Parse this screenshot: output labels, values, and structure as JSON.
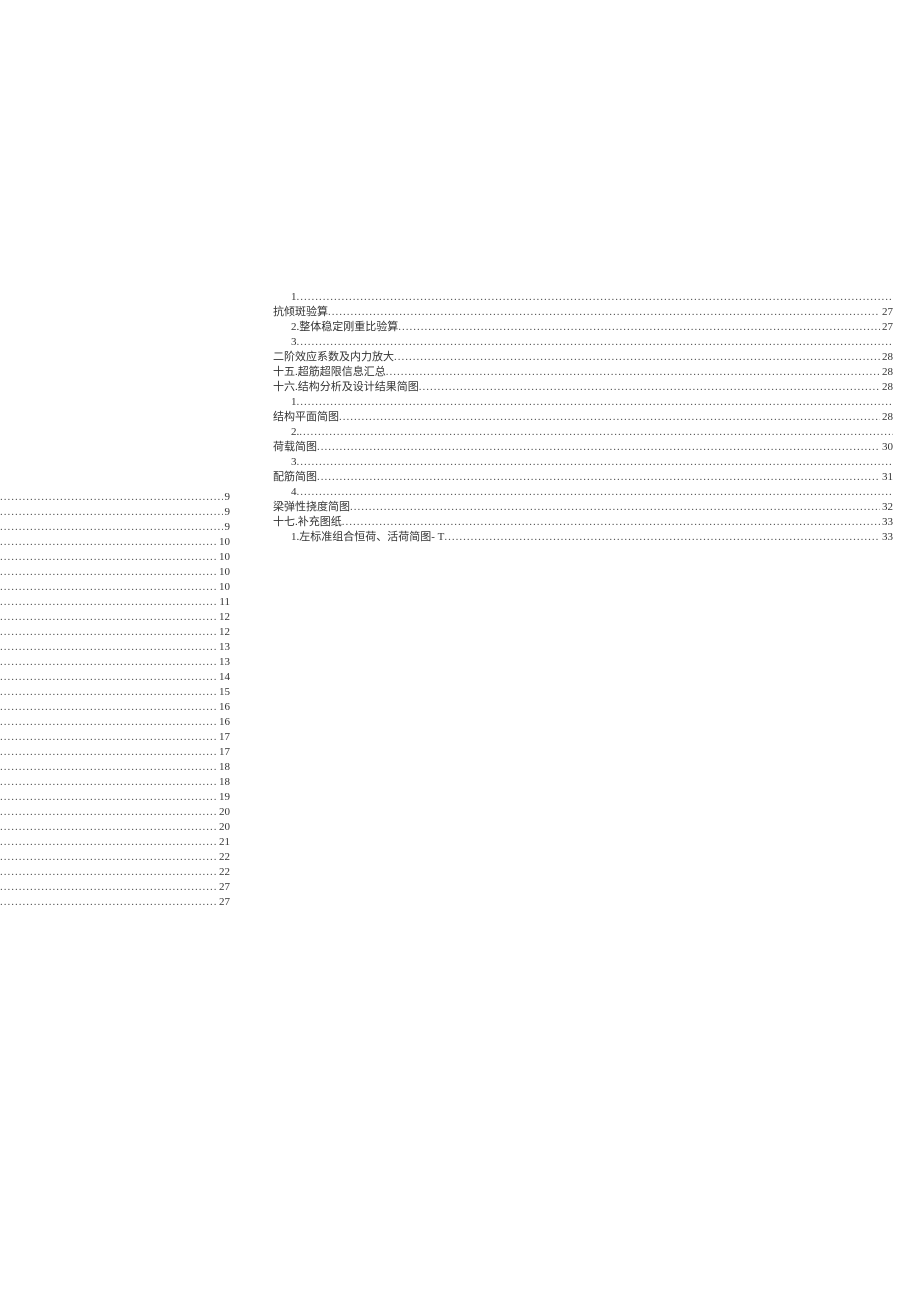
{
  "left_column": [
    {
      "title": "",
      "page": "9"
    },
    {
      "title": "",
      "page": "9"
    },
    {
      "title": "",
      "page": "9"
    },
    {
      "title": "",
      "page": "10"
    },
    {
      "title": "",
      "page": "10"
    },
    {
      "title": "",
      "page": "10"
    },
    {
      "title": "",
      "page": "10"
    },
    {
      "title": "",
      "page": "11"
    },
    {
      "title": "",
      "page": "12"
    },
    {
      "title": "",
      "page": "12"
    },
    {
      "title": "",
      "page": "13"
    },
    {
      "title": "",
      "page": "13"
    },
    {
      "title": "",
      "page": "14"
    },
    {
      "title": "",
      "page": "15"
    },
    {
      "title": "",
      "page": "16"
    },
    {
      "title": "",
      "page": "16"
    },
    {
      "title": "",
      "page": "17"
    },
    {
      "title": "",
      "page": "17"
    },
    {
      "title": "",
      "page": "18"
    },
    {
      "title": "",
      "page": "18"
    },
    {
      "title": "",
      "page": "19"
    },
    {
      "title": "",
      "page": "20"
    },
    {
      "title": "",
      "page": "20"
    },
    {
      "title": "",
      "page": "21"
    },
    {
      "title": "",
      "page": "22"
    },
    {
      "title": "",
      "page": "22"
    },
    {
      "title": "",
      "page": "27"
    },
    {
      "title": "",
      "page": "27"
    }
  ],
  "right_column": [
    {
      "title": "1",
      "page": "",
      "indent": true,
      "no_page": true
    },
    {
      "title": "抗倾斑验算",
      "page": "27"
    },
    {
      "title": "2.整体稳定刚重比验算",
      "page": "27",
      "indent": true
    },
    {
      "title": "3",
      "page": "",
      "indent": true,
      "no_page": true
    },
    {
      "title": "二阶效应系数及内力放大",
      "page": "28"
    },
    {
      "title": "十五.超筋超限信息汇总",
      "page": "28"
    },
    {
      "title": "十六.结构分析及设计结果简图",
      "page": "28"
    },
    {
      "title": "1",
      "page": "",
      "indent": true,
      "no_page": true
    },
    {
      "title": "结构平面简图",
      "page": "28"
    },
    {
      "title": "2.",
      "page": "",
      "indent": true,
      "no_page": true
    },
    {
      "title": "荷载简图",
      "page": "30"
    },
    {
      "title": "3",
      "page": "",
      "indent": true,
      "no_page": true
    },
    {
      "title": "配筋简图",
      "page": "31"
    },
    {
      "title": "4",
      "page": "",
      "indent": true,
      "no_page": true
    },
    {
      "title": "梁弹性挠度简图",
      "page": "32"
    },
    {
      "title": "十七.补充图纸",
      "page": "33"
    },
    {
      "title": "1.左标准组合恒荷、活荷简图- T",
      "page": "33",
      "indent": true
    }
  ]
}
